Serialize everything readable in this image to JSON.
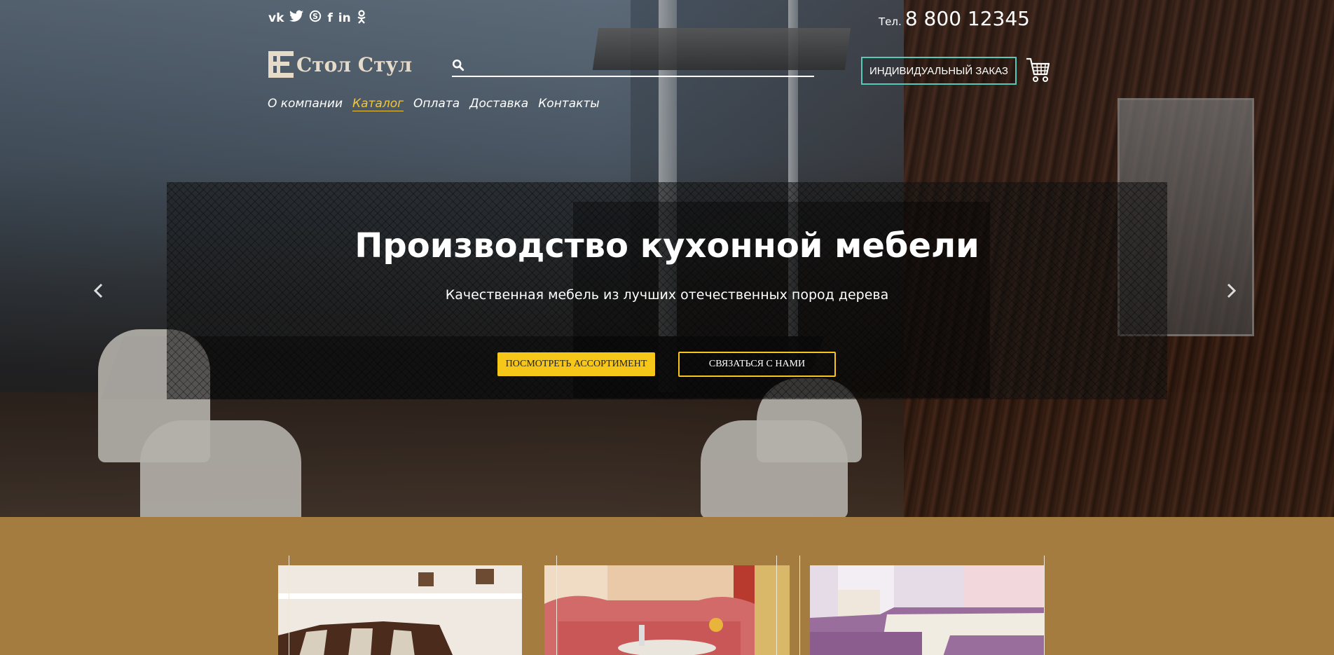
{
  "header": {
    "social_icons": [
      "vk-icon",
      "twitter-icon",
      "skype-icon",
      "facebook-icon",
      "linkedin-icon",
      "odnoklassniki-icon"
    ],
    "social_glyphs": [
      "vk",
      "❧",
      "S",
      "f",
      "in",
      "ok"
    ],
    "phone_label": "Тел.",
    "phone_number": "8 800 12345",
    "logo_text": "Стол Стул",
    "search": {
      "placeholder": "",
      "value": ""
    },
    "order_button": "ИНДИВИДУАЛЬНЫЙ ЗАКАЗ",
    "cart_icon": "cart-icon"
  },
  "nav": {
    "items": [
      {
        "label": "О компании",
        "active": false
      },
      {
        "label": "Каталог",
        "active": true
      },
      {
        "label": "Оплата",
        "active": false
      },
      {
        "label": "Доставка",
        "active": false
      },
      {
        "label": "Контакты",
        "active": false
      }
    ]
  },
  "slider": {
    "title": "Производство кухонной мебели",
    "subtitle": "Качественная мебель из лучших отечественных пород дерева",
    "primary_button": "ПОСМОТРЕТЬ АССОРТИМЕНТ",
    "secondary_button": "СВЯЗАТЬСЯ С НАМИ",
    "prev_icon": "chevron-left-icon",
    "next_icon": "chevron-right-icon"
  },
  "colors": {
    "accent_yellow": "#f6c619",
    "accent_teal": "#58c9b9",
    "section_bg": "#a47c3f",
    "nav_active": "#f3c63b"
  },
  "products": [
    {
      "image": "kitchen-corner-sofa-brown"
    },
    {
      "image": "kitchen-corner-sofa-red"
    },
    {
      "image": "kitchen-corner-sofa-purple"
    }
  ]
}
